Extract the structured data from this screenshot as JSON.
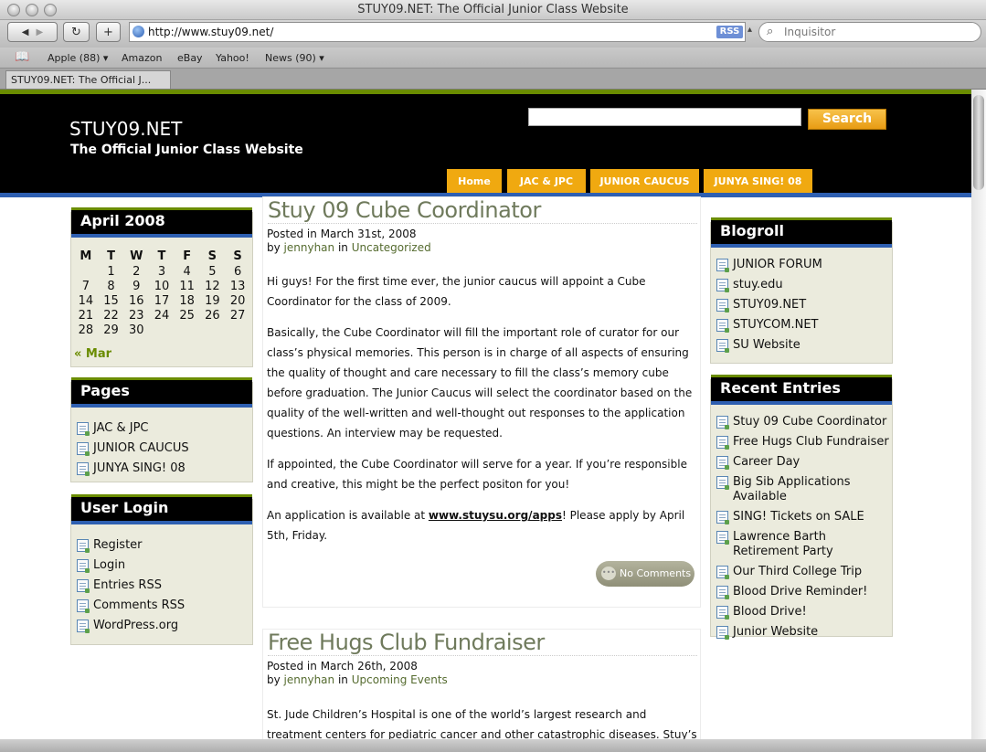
{
  "window": {
    "title": "STUY09.NET: The Official Junior Class Website"
  },
  "toolbar": {
    "url": "http://www.stuy09.net/",
    "rss": "RSS",
    "search_placeholder": "Inquisitor"
  },
  "bookmarks": [
    "Apple (88) ▾",
    "Amazon",
    "eBay",
    "Yahoo!",
    "News (90) ▾"
  ],
  "tab": {
    "label": "STUY09.NET: The Official J..."
  },
  "site": {
    "name": "STUY09.NET",
    "description": "The Official Junior Class Website",
    "search_button": "Search"
  },
  "nav": [
    "Home",
    "JAC & JPC",
    "JUNIOR CAUCUS",
    "JUNYA SING! 08"
  ],
  "calendar": {
    "title": "April 2008",
    "days": [
      "M",
      "T",
      "W",
      "T",
      "F",
      "S",
      "S"
    ],
    "weeks": [
      [
        "",
        "1",
        "2",
        "3",
        "4",
        "5",
        "6"
      ],
      [
        "7",
        "8",
        "9",
        "10",
        "11",
        "12",
        "13"
      ],
      [
        "14",
        "15",
        "16",
        "17",
        "18",
        "19",
        "20"
      ],
      [
        "21",
        "22",
        "23",
        "24",
        "25",
        "26",
        "27"
      ],
      [
        "28",
        "29",
        "30",
        "",
        "",
        "",
        ""
      ]
    ],
    "prev": "« Mar"
  },
  "pages": {
    "title": "Pages",
    "items": [
      "JAC & JPC",
      "JUNIOR CAUCUS",
      "JUNYA SING! 08"
    ]
  },
  "login": {
    "title": "User Login",
    "items": [
      "Register",
      "Login",
      "Entries RSS",
      "Comments RSS",
      "WordPress.org"
    ]
  },
  "blogroll": {
    "title": "Blogroll",
    "items": [
      "JUNIOR FORUM",
      "stuy.edu",
      "STUY09.NET",
      "STUYCOM.NET",
      "SU Website"
    ]
  },
  "recent": {
    "title": "Recent Entries",
    "items": [
      "Stuy 09 Cube Coordinator",
      "Free Hugs Club Fundraiser",
      "Career Day",
      "Big Sib Applications Available",
      "SING! Tickets on SALE",
      "Lawrence Barth Retirement Party",
      "Our Third College Trip",
      "Blood Drive Reminder!",
      "Blood Drive!",
      "Junior Website"
    ]
  },
  "posts": [
    {
      "title": "Stuy 09 Cube Coordinator",
      "posted_label": "Posted in",
      "date": "March 31st, 2008",
      "by_label": "by",
      "author": "jennyhan",
      "in_label": "in",
      "category": "Uncategorized",
      "p1": "Hi guys! For the first time ever, the junior caucus will appoint a Cube Coordinator for the class of 2009.",
      "p2": "Basically, the Cube Coordinator will fill the important role of curator for our class’s physical memories. This person is in charge of all aspects of ensuring the quality of thought and care necessary to fill the class’s memory cube before graduation. The Junior Caucus will select the coordinator based on the quality of the well-written and well-thought out responses to the application questions. An interview may be requested.",
      "p3": "If appointed, the Cube Coordinator will serve for a year. If you’re responsible and creative, this might be the perfect positon for you!",
      "p4_pre": "An application is available at ",
      "p4_link": "www.stuysu.org/apps",
      "p4_post": "! Please apply by April 5th, Friday.",
      "comments": "No Comments"
    },
    {
      "title": "Free Hugs Club Fundraiser",
      "posted_label": "Posted in",
      "date": "March 26th, 2008",
      "by_label": "by",
      "author": "jennyhan",
      "in_label": "in",
      "category": "Upcoming Events",
      "p1": "St. Jude Children’s Hospital is one of the world’s largest research and treatment centers for pediatric cancer and other catastrophic diseases. Stuy’s Free Hugs Club has the"
    }
  ]
}
